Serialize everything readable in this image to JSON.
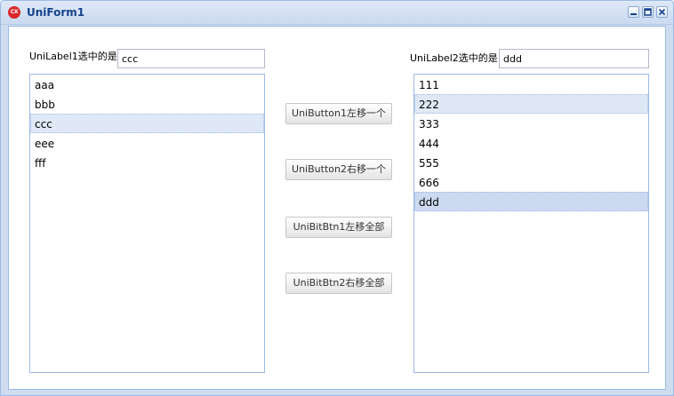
{
  "window": {
    "title": "UniForm1",
    "icon_text": "CX"
  },
  "left": {
    "label": "UniLabel1选中的是",
    "edit_value": "ccc",
    "items": [
      {
        "text": "aaa"
      },
      {
        "text": "bbb"
      },
      {
        "text": "ccc",
        "selected": true
      },
      {
        "text": "eee"
      },
      {
        "text": "fff"
      }
    ]
  },
  "right": {
    "label": "UniLabel2选中的是",
    "edit_value": "ddd",
    "items": [
      {
        "text": "111"
      },
      {
        "text": "222",
        "selected": true
      },
      {
        "text": "333"
      },
      {
        "text": "444"
      },
      {
        "text": "555"
      },
      {
        "text": "666"
      },
      {
        "text": "ddd",
        "selected_strong": true
      }
    ]
  },
  "buttons": {
    "move_left_one": "UniButton1左移一个",
    "move_right_one": "UniButton2右移一个",
    "move_left_all": "UniBitBtn1左移全部",
    "move_right_all": "UniBitBtn2右移全部"
  },
  "colors": {
    "title_text": "#15428b",
    "border": "#99bbe8",
    "selection": "#dfe8f6"
  }
}
